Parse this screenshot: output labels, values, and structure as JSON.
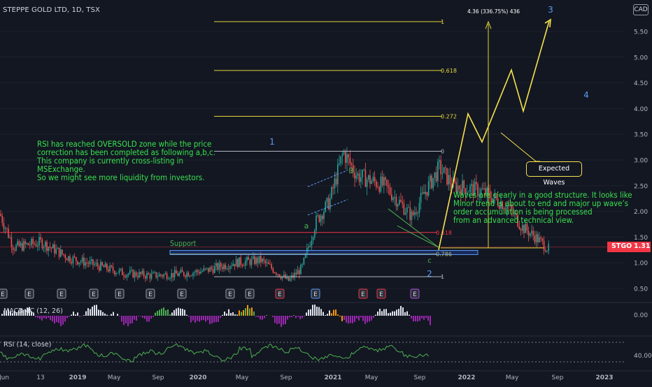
{
  "header": {
    "title": "STEPPE GOLD LTD, 1D, TSX",
    "currency": "CAD"
  },
  "price_tag": {
    "symbol": "STGO",
    "price": "1.31"
  },
  "panes": {
    "macd_label": "MACD 4C (12, 26)",
    "rsi_label": "RSI (14, close)"
  },
  "annotations": {
    "left_note": "RSI has reached OVERSOLD zone while the price\n correction has been completed as following a,b,c.\nThis company is currently cross-listing in MSExchange.\nSo we might see more liquidity from investors.",
    "right_note": "Waves are clearly in a good structure. It looks like\n Minor trend is about to end and major up wave’s\n order accumulation is being processed\n from an advanced technical view.",
    "support_label": "Support",
    "expected_waves": "Expected Waves",
    "target_label": "4.36 (336.75%) 436"
  },
  "chart_data": {
    "type": "line",
    "symbol": "STGO",
    "exchange": "TSX",
    "interval": "1D",
    "currency": "CAD",
    "y_axis": {
      "min": 0.5,
      "max": 5.5,
      "ticks": [
        5.5,
        5.0,
        4.5,
        4.0,
        3.5,
        3.0,
        2.5,
        2.0,
        1.5,
        1.0,
        0.5
      ]
    },
    "x_axis": {
      "ticks": [
        "Jun",
        "13",
        "2019",
        "May",
        "Sep",
        "2020",
        "May",
        "Sep",
        "2021",
        "May",
        "Sep",
        "2022",
        "May",
        "Sep",
        "2023"
      ]
    },
    "last_price": 1.31,
    "price_path_approx": [
      [
        "2018-06",
        1.95
      ],
      [
        "2018-07",
        1.3
      ],
      [
        "2018-09",
        1.4
      ],
      [
        "2018-11",
        1.1
      ],
      [
        "2019-01",
        0.95
      ],
      [
        "2019-03",
        0.8
      ],
      [
        "2019-05",
        0.75
      ],
      [
        "2019-07",
        0.78
      ],
      [
        "2019-09",
        0.85
      ],
      [
        "2019-11",
        1.0
      ],
      [
        "2020-01",
        1.05
      ],
      [
        "2020-03",
        0.65
      ],
      [
        "2020-04",
        0.9
      ],
      [
        "2020-05",
        1.8
      ],
      [
        "2020-06",
        2.2
      ],
      [
        "2020-07",
        3.15
      ],
      [
        "2020-08",
        2.7
      ],
      [
        "2020-10",
        2.5
      ],
      [
        "2020-12",
        1.9
      ],
      [
        "2021-01",
        2.4
      ],
      [
        "2021-02",
        2.85
      ],
      [
        "2021-03",
        2.5
      ],
      [
        "2021-05",
        2.4
      ],
      [
        "2021-07",
        2.1
      ],
      [
        "2021-08",
        1.7
      ],
      [
        "2021-09",
        1.5
      ],
      [
        "2021-10",
        1.25
      ]
    ],
    "fibonacci_levels": [
      {
        "label": "1",
        "value": 5.69,
        "color": "#e2d33a"
      },
      {
        "label": "0.618",
        "value": 4.74,
        "color": "#e2d33a"
      },
      {
        "label": "0.272",
        "value": 3.85,
        "color": "#e2d33a"
      },
      {
        "label": "0",
        "value": 3.17,
        "color": "#b2b5be"
      },
      {
        "label": "0.618",
        "value": 1.59,
        "color": "#f23645"
      },
      {
        "label": "0.786",
        "value": 1.17,
        "color": "#e2d33a"
      },
      {
        "label": "1",
        "value": 0.73,
        "color": "#b2b5be"
      }
    ],
    "support_zone": [
      1.16,
      1.24
    ],
    "projected_path": [
      1.25,
      3.9,
      3.35,
      4.75,
      3.95,
      5.7
    ],
    "wave_labels": [
      {
        "text": "1",
        "color": "#5b9cf6"
      },
      {
        "text": "2",
        "color": "#5b9cf6"
      },
      {
        "text": "3",
        "color": "#5b9cf6"
      },
      {
        "text": "4",
        "color": "#5b9cf6"
      },
      {
        "text": "a",
        "color": "#4caf50"
      },
      {
        "text": "B",
        "color": "#4caf50"
      },
      {
        "text": "c",
        "color": "#4caf50"
      }
    ],
    "earnings_markers": [
      "E",
      "E",
      "E",
      "E",
      "E",
      "E",
      "E",
      "E",
      "E",
      "E",
      "E",
      "E",
      "E",
      "E"
    ],
    "macd_axis": {
      "ticks": [
        "0.00"
      ]
    },
    "rsi_axis": {
      "ticks": [
        "40.00"
      ]
    }
  }
}
